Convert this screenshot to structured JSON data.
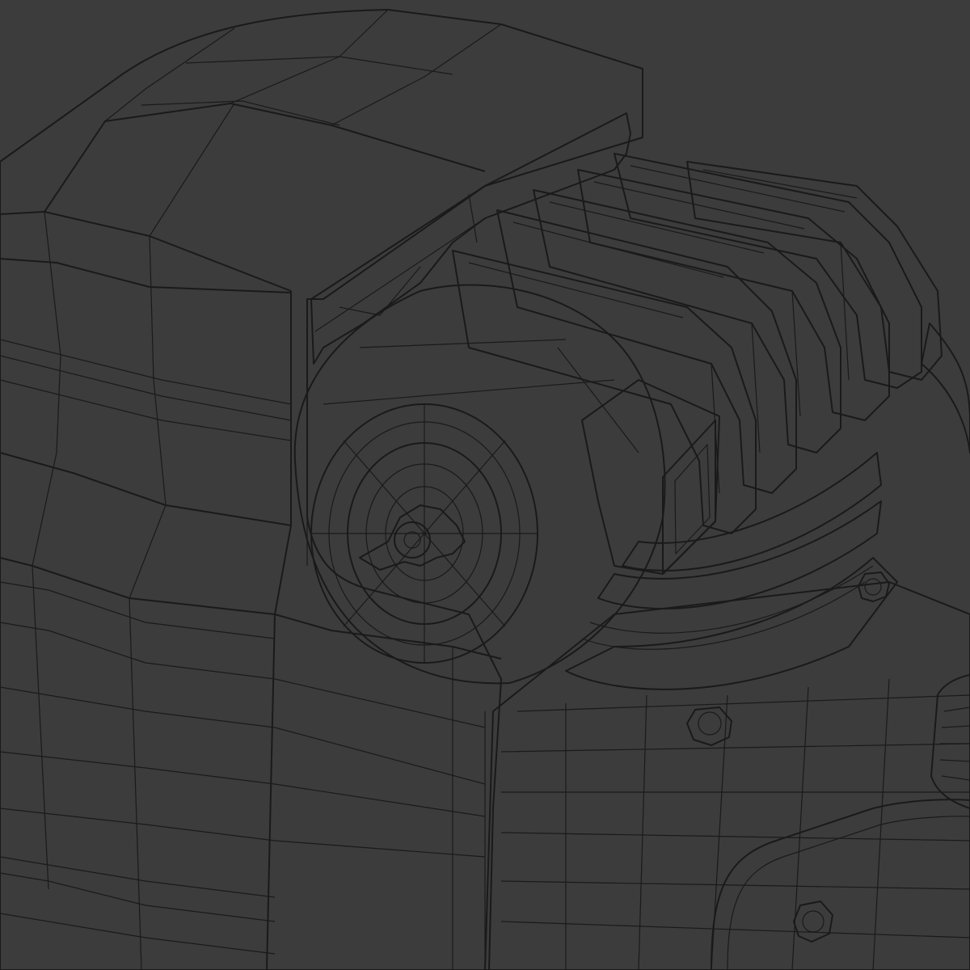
{
  "scene": {
    "subject": "air-compressor",
    "view": "wireframe-render",
    "colors": {
      "background": "#3c3c3c",
      "surface": "#e6e6e6",
      "surface_shade": "#cfcfcf",
      "cavity": "#7e7e7e",
      "wire": "#1a1a1a"
    },
    "parts": [
      "motor-housing",
      "housing-vent-opening",
      "cylinder-cooling-fins",
      "cylinder-head",
      "air-intake-filter",
      "intake-filter-knob",
      "intake-elbow",
      "crankcase",
      "cylinder-bolts",
      "oil-cap",
      "discharge-tube"
    ],
    "fin_count": 6,
    "bolt_count": 3
  }
}
